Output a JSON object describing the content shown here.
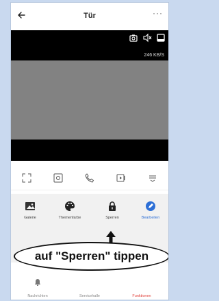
{
  "header": {
    "title": "Tür",
    "more_label": "···"
  },
  "video": {
    "speed": "246 KB/S"
  },
  "functions": [
    {
      "label": "Galerie",
      "icon": "gallery-icon"
    },
    {
      "label": "Themenfarbe",
      "icon": "palette-icon"
    },
    {
      "label": "Sperren",
      "icon": "lock-icon"
    },
    {
      "label": "Bearbeiten",
      "icon": "edit-icon"
    }
  ],
  "annotation": {
    "callout_text": "auf \"Sperren\" tippen"
  },
  "tabbar": [
    {
      "label": "Nachrichten",
      "icon": "bell-icon"
    },
    {
      "label": "Servicehalle",
      "icon": "service-icon"
    },
    {
      "label": "Funktionen",
      "icon": "functions-icon",
      "active": true
    }
  ],
  "colors": {
    "accent_blue": "#2d6fd6",
    "active_red": "#e0403a",
    "backdrop": "#c9d9ef"
  }
}
